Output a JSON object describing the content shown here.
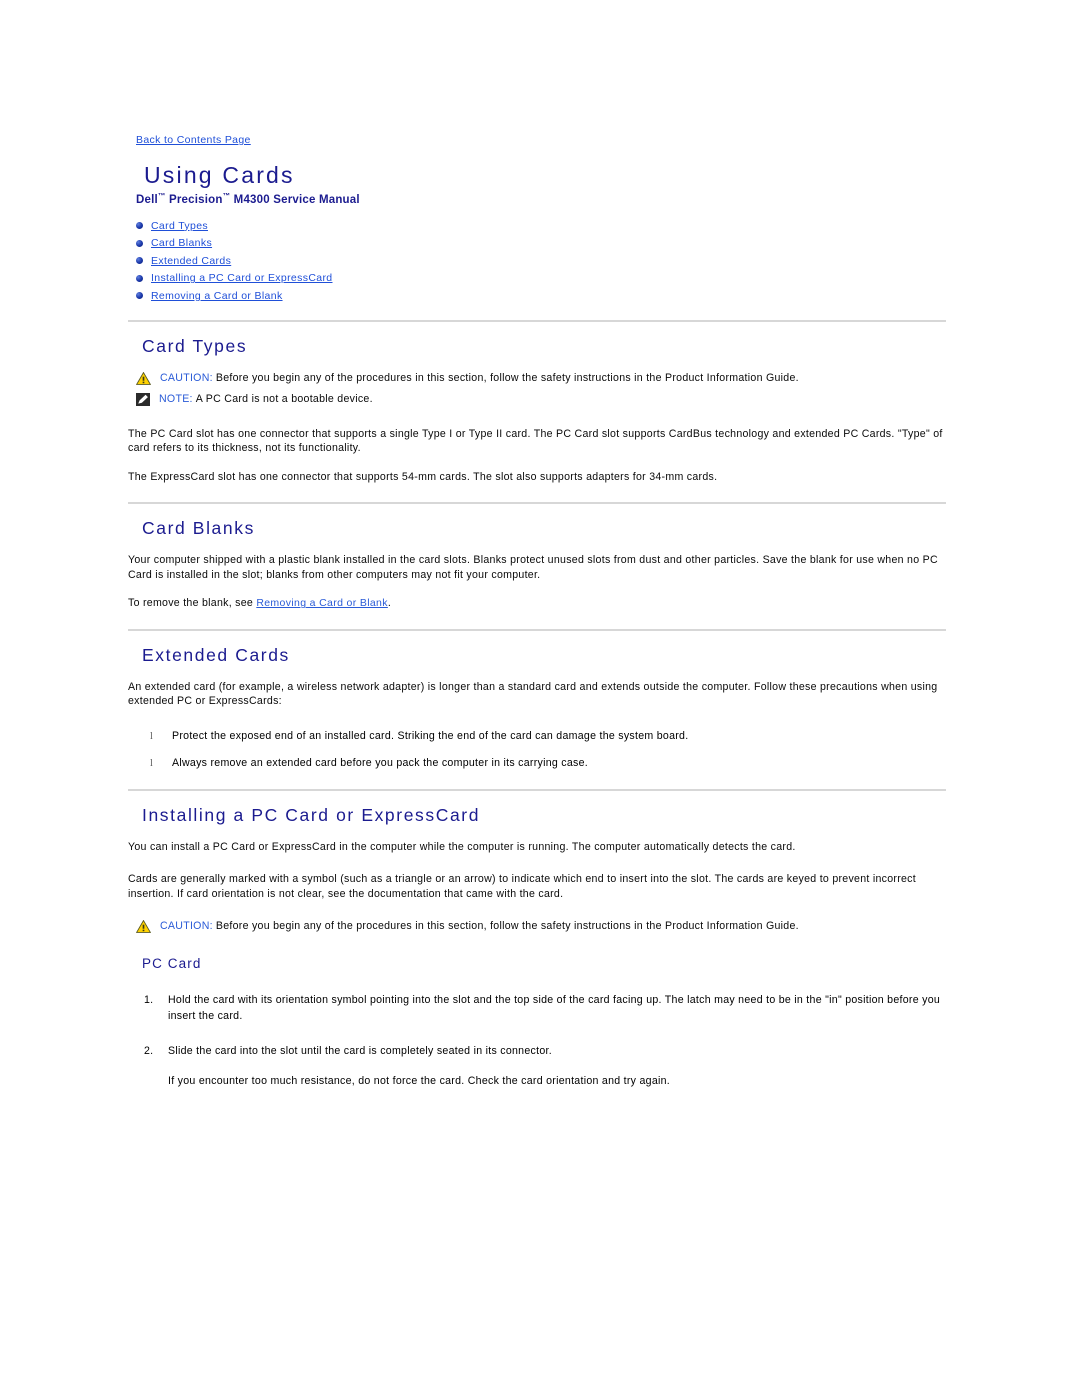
{
  "page": {
    "back_link": "Back to Contents Page",
    "title": "Using Cards",
    "subtitle_pre": "Dell",
    "subtitle_tm1": "™",
    "subtitle_mid": " Precision",
    "subtitle_tm2": "™",
    "subtitle_post": " M4300  Service Manual"
  },
  "toc": [
    {
      "label": "Card Types"
    },
    {
      "label": "Card Blanks"
    },
    {
      "label": "Extended Cards"
    },
    {
      "label": "Installing a PC Card or ExpressCard"
    },
    {
      "label": "Removing a Card or Blank"
    }
  ],
  "sections": {
    "card_types": {
      "heading": "Card Types",
      "caution_label": "CAUTION:",
      "caution_text": "Before you begin any of the procedures in this section, follow the safety instructions in the Product Information Guide.",
      "note_label": "NOTE:",
      "note_text": "A PC Card is not a bootable device.",
      "p1": "The PC Card slot has one connector that supports a single Type I or Type II card. The PC Card slot supports CardBus technology and extended PC Cards. \"Type\" of card refers to its thickness, not its functionality.",
      "p2": "The ExpressCard slot has one connector that supports 54-mm cards. The slot also supports adapters for 34-mm cards."
    },
    "card_blanks": {
      "heading": "Card Blanks",
      "p1": "Your computer shipped with a plastic blank installed in the card slots. Blanks protect unused slots from dust and other particles. Save the blank for use when no PC Card is installed in the slot; blanks from other computers may not fit your computer.",
      "p2_pre": "To remove the blank, see ",
      "p2_link": "Removing a Card or Blank",
      "p2_post": "."
    },
    "extended_cards": {
      "heading": "Extended Cards",
      "p1": "An extended card (for example, a wireless network adapter) is longer than a standard card and extends outside the computer. Follow these precautions when using extended PC or ExpressCards:",
      "bullets": [
        "Protect the exposed end of an installed card. Striking the end of the card can damage the system board.",
        "Always remove an extended card before you pack the computer in its carrying case."
      ],
      "bullet_marker": "l"
    },
    "installing": {
      "heading": "Installing a PC Card or ExpressCard",
      "p1": "You can install a PC Card or ExpressCard in the computer while the computer is running. The computer automatically detects the card.",
      "p2": "Cards are generally marked with a symbol (such as a triangle or an arrow) to indicate which end to insert into the slot. The cards are keyed to prevent incorrect insertion. If card orientation is not clear, see the documentation that came with the card.",
      "caution_label": "CAUTION:",
      "caution_text": "Before you begin any of the procedures in this section, follow the safety instructions in the Product Information Guide."
    },
    "pc_card": {
      "heading": "PC Card",
      "steps": [
        {
          "num": "1.",
          "text": "Hold the card with its orientation symbol pointing into the slot and the top side of the card facing up. The latch may need to be in the \"in\" position before you insert the card."
        },
        {
          "num": "2.",
          "text": "Slide the card into the slot until the card is completely seated in its connector."
        }
      ],
      "after_step2": "If you encounter too much resistance, do not force the card. Check the card orientation and try again."
    }
  },
  "colors": {
    "heading_navy": "#1B1B8F",
    "link_blue": "#1F4FD8",
    "rule_gray": "#d7d7d7",
    "caution_yellow": "#FFD200"
  },
  "icons": {
    "caution": "warning-triangle-icon",
    "note": "note-pencil-icon"
  }
}
